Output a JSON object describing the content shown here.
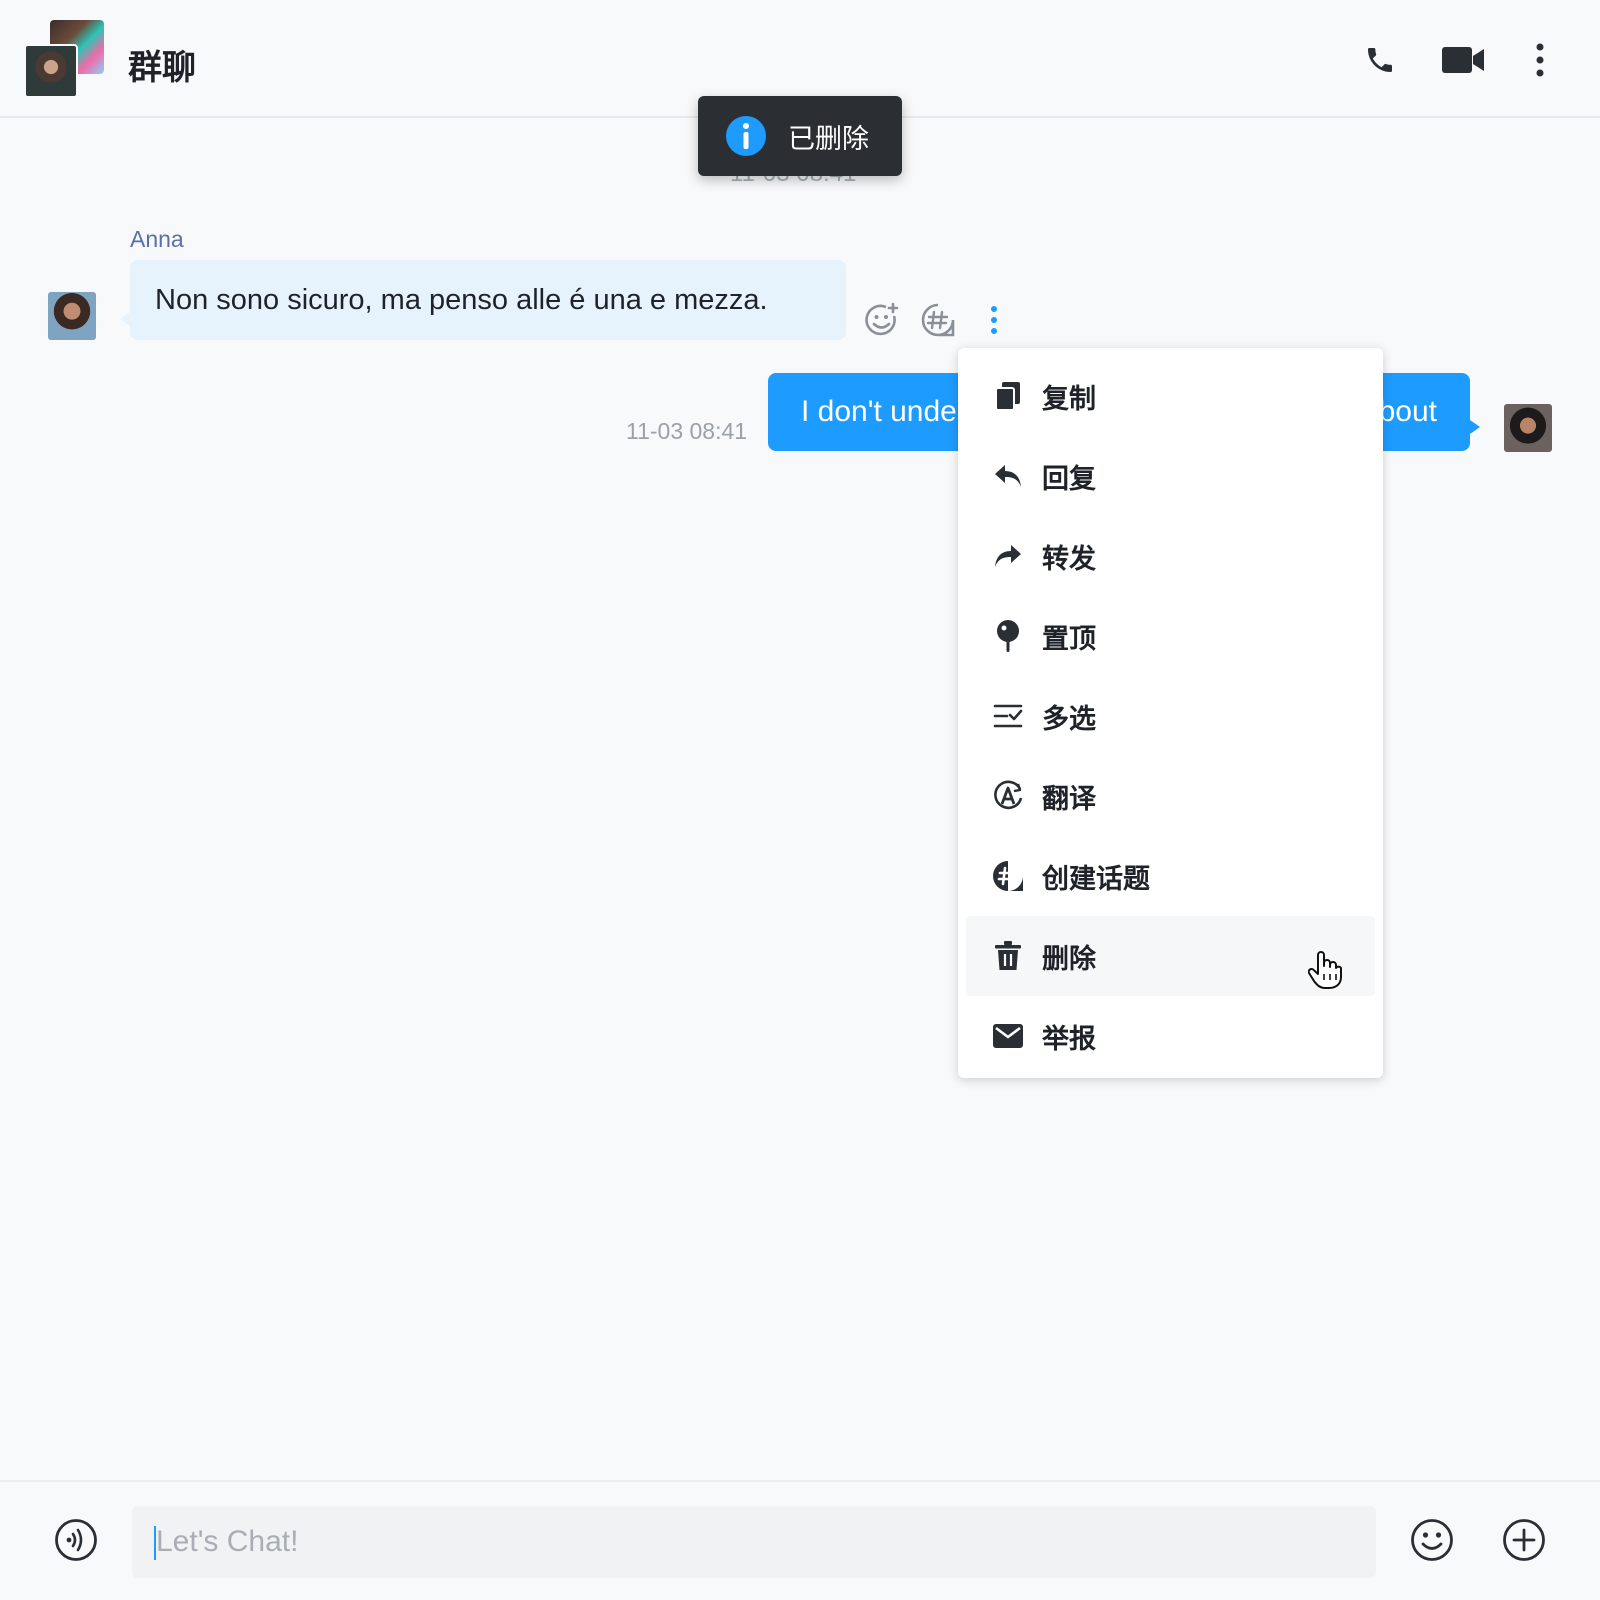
{
  "header": {
    "title": "群聊",
    "icons": [
      "phone-icon",
      "video-camera-icon",
      "more-vertical-icon"
    ]
  },
  "toast": {
    "text": "已删除",
    "icon": "info-icon",
    "color": "#1e9bff"
  },
  "messages": [
    {
      "sender": "Anna",
      "text": "Non sono sicuro, ma penso alle é una e mezza.",
      "direction": "incoming",
      "actions": [
        "emoji-add-icon",
        "topic-hash-icon",
        "more-vertical-icon"
      ]
    },
    {
      "text": "I don't unde",
      "text_tail": "bout",
      "timestamp": "11-03 08:41",
      "direction": "outgoing",
      "bubble_color": "#1e9bff"
    }
  ],
  "context_menu": {
    "items": [
      {
        "label": "复制",
        "icon": "copy-icon"
      },
      {
        "label": "回复",
        "icon": "reply-icon"
      },
      {
        "label": "转发",
        "icon": "forward-icon"
      },
      {
        "label": "置顶",
        "icon": "pin-icon"
      },
      {
        "label": "多选",
        "icon": "multi-select-icon"
      },
      {
        "label": "翻译",
        "icon": "translate-icon"
      },
      {
        "label": "创建话题",
        "icon": "create-topic-icon"
      },
      {
        "label": "删除",
        "icon": "trash-icon",
        "hovered": true
      },
      {
        "label": "举报",
        "icon": "report-mail-icon"
      }
    ]
  },
  "composer": {
    "placeholder": "Let's Chat!",
    "value": "",
    "icons": [
      "voice-icon",
      "emoji-icon",
      "plus-icon"
    ]
  }
}
